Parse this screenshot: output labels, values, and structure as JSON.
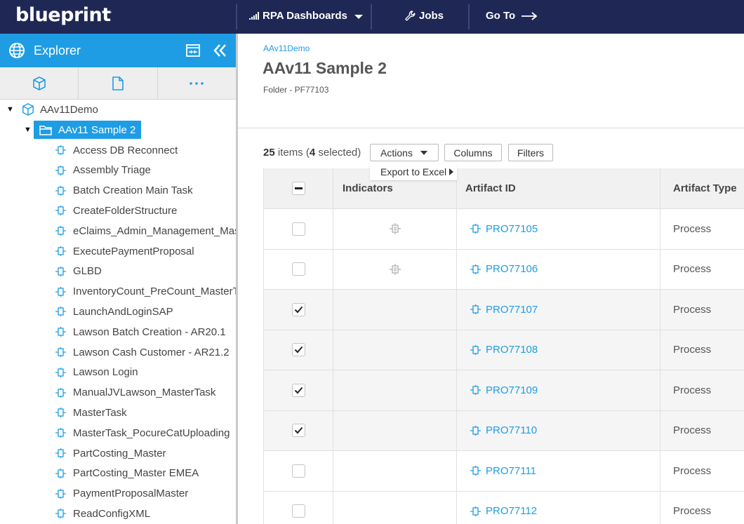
{
  "topbar": {
    "logo": "blueprint",
    "logo_mark": ".",
    "nav": [
      {
        "label": "RPA Dashboards",
        "icon": "signal-bars-icon",
        "trailing_icon": "caret-down-icon"
      },
      {
        "label": "Jobs",
        "icon": "wrench-icon"
      },
      {
        "label": "Go To",
        "trailing_icon": "arrow-right-icon"
      }
    ]
  },
  "sidebar": {
    "title": "Explorer",
    "icons": [
      "globe-icon",
      "split-view-icon",
      "collapse-double-chevron-icon"
    ],
    "tabs": [
      "cube-icon",
      "document-icon",
      "more-dots-icon"
    ],
    "tree": {
      "root": "AAv11Demo",
      "folder": "AAv11 Sample 2",
      "items": [
        "Access DB Reconnect",
        "Assembly Triage",
        "Batch Creation Main Task",
        "CreateFolderStructure",
        "eClaims_Admin_Management_Mas",
        "ExecutePaymentProposal",
        "GLBD",
        "InventoryCount_PreCount_MasterT",
        "LaunchAndLoginSAP",
        "Lawson Batch Creation - AR20.1",
        "Lawson Cash Customer - AR21.2",
        "Lawson Login",
        "ManualJVLawson_MasterTask",
        "MasterTask",
        "MasterTask_PocureCatUploading",
        "PartCosting_Master",
        "PartCosting_Master EMEA",
        "PaymentProposalMaster",
        "ReadConfigXML"
      ]
    }
  },
  "main": {
    "breadcrumb": "AAv11Demo",
    "title": "AAv11 Sample 2",
    "subtitle": "Folder - PF77103",
    "count": {
      "total": "25",
      "items_word": "items",
      "selected_open": "(",
      "selected": "4",
      "selected_word": "selected)"
    },
    "buttons": {
      "actions": "Actions",
      "columns": "Columns",
      "filters": "Filters"
    },
    "actions_menu": {
      "export": "Export to Excel"
    },
    "grid": {
      "headers": {
        "indicators": "Indicators",
        "artifact_id": "Artifact ID",
        "artifact_type": "Artifact Type"
      },
      "rows": [
        {
          "id": "PRO77105",
          "type": "Process",
          "checked": false,
          "indicator": true
        },
        {
          "id": "PRO77106",
          "type": "Process",
          "checked": false,
          "indicator": true
        },
        {
          "id": "PRO77107",
          "type": "Process",
          "checked": true,
          "indicator": false
        },
        {
          "id": "PRO77108",
          "type": "Process",
          "checked": true,
          "indicator": false
        },
        {
          "id": "PRO77109",
          "type": "Process",
          "checked": true,
          "indicator": false
        },
        {
          "id": "PRO77110",
          "type": "Process",
          "checked": true,
          "indicator": false
        },
        {
          "id": "PRO77111",
          "type": "Process",
          "checked": false,
          "indicator": false
        },
        {
          "id": "PRO77112",
          "type": "Process",
          "checked": false,
          "indicator": false
        }
      ]
    }
  },
  "colors": {
    "navy": "#1f2855",
    "accent": "#1e9de4"
  }
}
